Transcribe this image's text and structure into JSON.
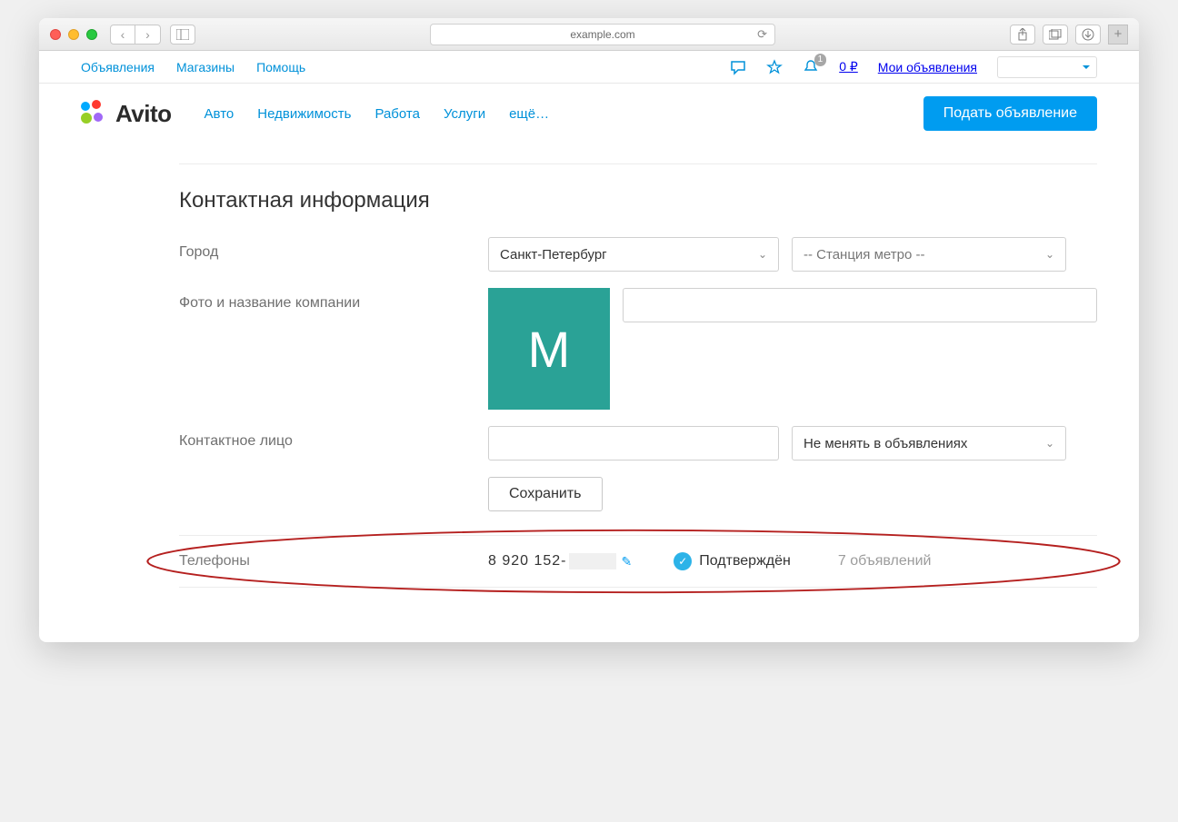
{
  "browser": {
    "url": "example.com"
  },
  "topbar": {
    "links": [
      "Объявления",
      "Магазины",
      "Помощь"
    ],
    "notif_count": "1",
    "balance": "0 ₽",
    "my_ads": "Мои объявления"
  },
  "logo_text": "Avito",
  "nav": [
    "Авто",
    "Недвижимость",
    "Работа",
    "Услуги",
    "ещё…"
  ],
  "post_button": "Подать объявление",
  "section_title": "Контактная информация",
  "form": {
    "city_label": "Город",
    "city_value": "Санкт-Петербург",
    "metro_placeholder": "-- Станция метро --",
    "company_label": "Фото и название компании",
    "company_initial": "М",
    "contact_label": "Контактное лицо",
    "contact_select": "Не менять в объявлениях",
    "save": "Сохранить"
  },
  "phones": {
    "label": "Телефоны",
    "number": "8 920 152-",
    "verified": "Подтверждён",
    "count": "7 объявлений"
  }
}
